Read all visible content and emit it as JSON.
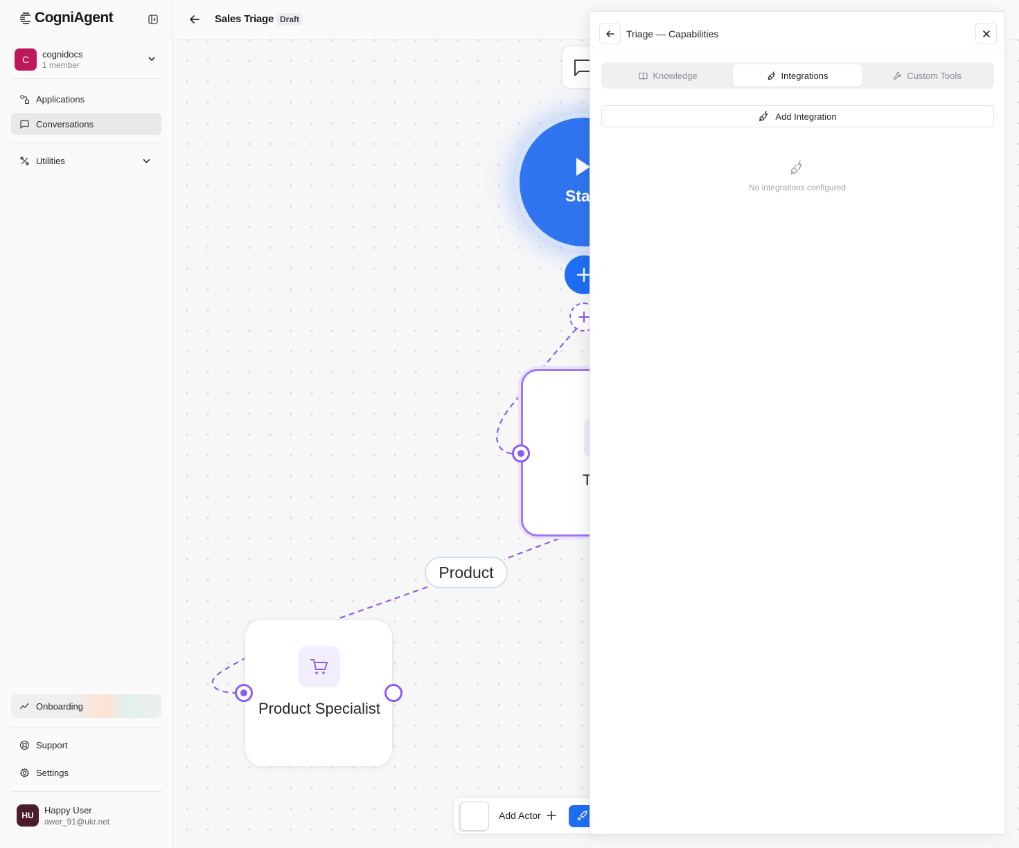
{
  "brand": {
    "name": "CogniAgent"
  },
  "org": {
    "name": "cognidocs",
    "members": "1 member",
    "initial": "C"
  },
  "nav": {
    "applications": "Applications",
    "conversations": "Conversations",
    "utilities": "Utilities",
    "onboarding": "Onboarding",
    "support": "Support",
    "settings": "Settings"
  },
  "user": {
    "initials": "HU",
    "name": "Happy User",
    "email": "awer_91@ukr.net"
  },
  "header": {
    "title": "Sales Triage",
    "status": "Draft"
  },
  "canvas": {
    "start_label": "Sta",
    "triage_label": "T",
    "edge_label": "Product",
    "product_node_label": "Product Specialist",
    "add_actor": "Add Actor"
  },
  "panel": {
    "title": "Triage — Capabilities",
    "tabs": [
      {
        "label": "Knowledge",
        "active": false
      },
      {
        "label": "Integrations",
        "active": true
      },
      {
        "label": "Custom Tools",
        "active": false
      }
    ],
    "add_button": "Add Integration",
    "empty_message": "No integrations configured"
  },
  "colors": {
    "accent": "#8a5cf5",
    "primary_blue": "#1f6ff5",
    "start_node": "#2f75f0",
    "org_avatar": "#be185d",
    "user_avatar": "#4a1d2b"
  },
  "icons": [
    "collapse-sidebar-icon",
    "chevron-down-icon",
    "applications-icon",
    "chat-icon",
    "utilities-icon",
    "onboarding-chart-icon",
    "support-icon",
    "settings-icon",
    "arrow-left-icon",
    "play-icon",
    "plus-icon",
    "cart-icon",
    "rocket-icon",
    "book-icon",
    "plug-icon",
    "wrench-icon",
    "close-icon"
  ]
}
